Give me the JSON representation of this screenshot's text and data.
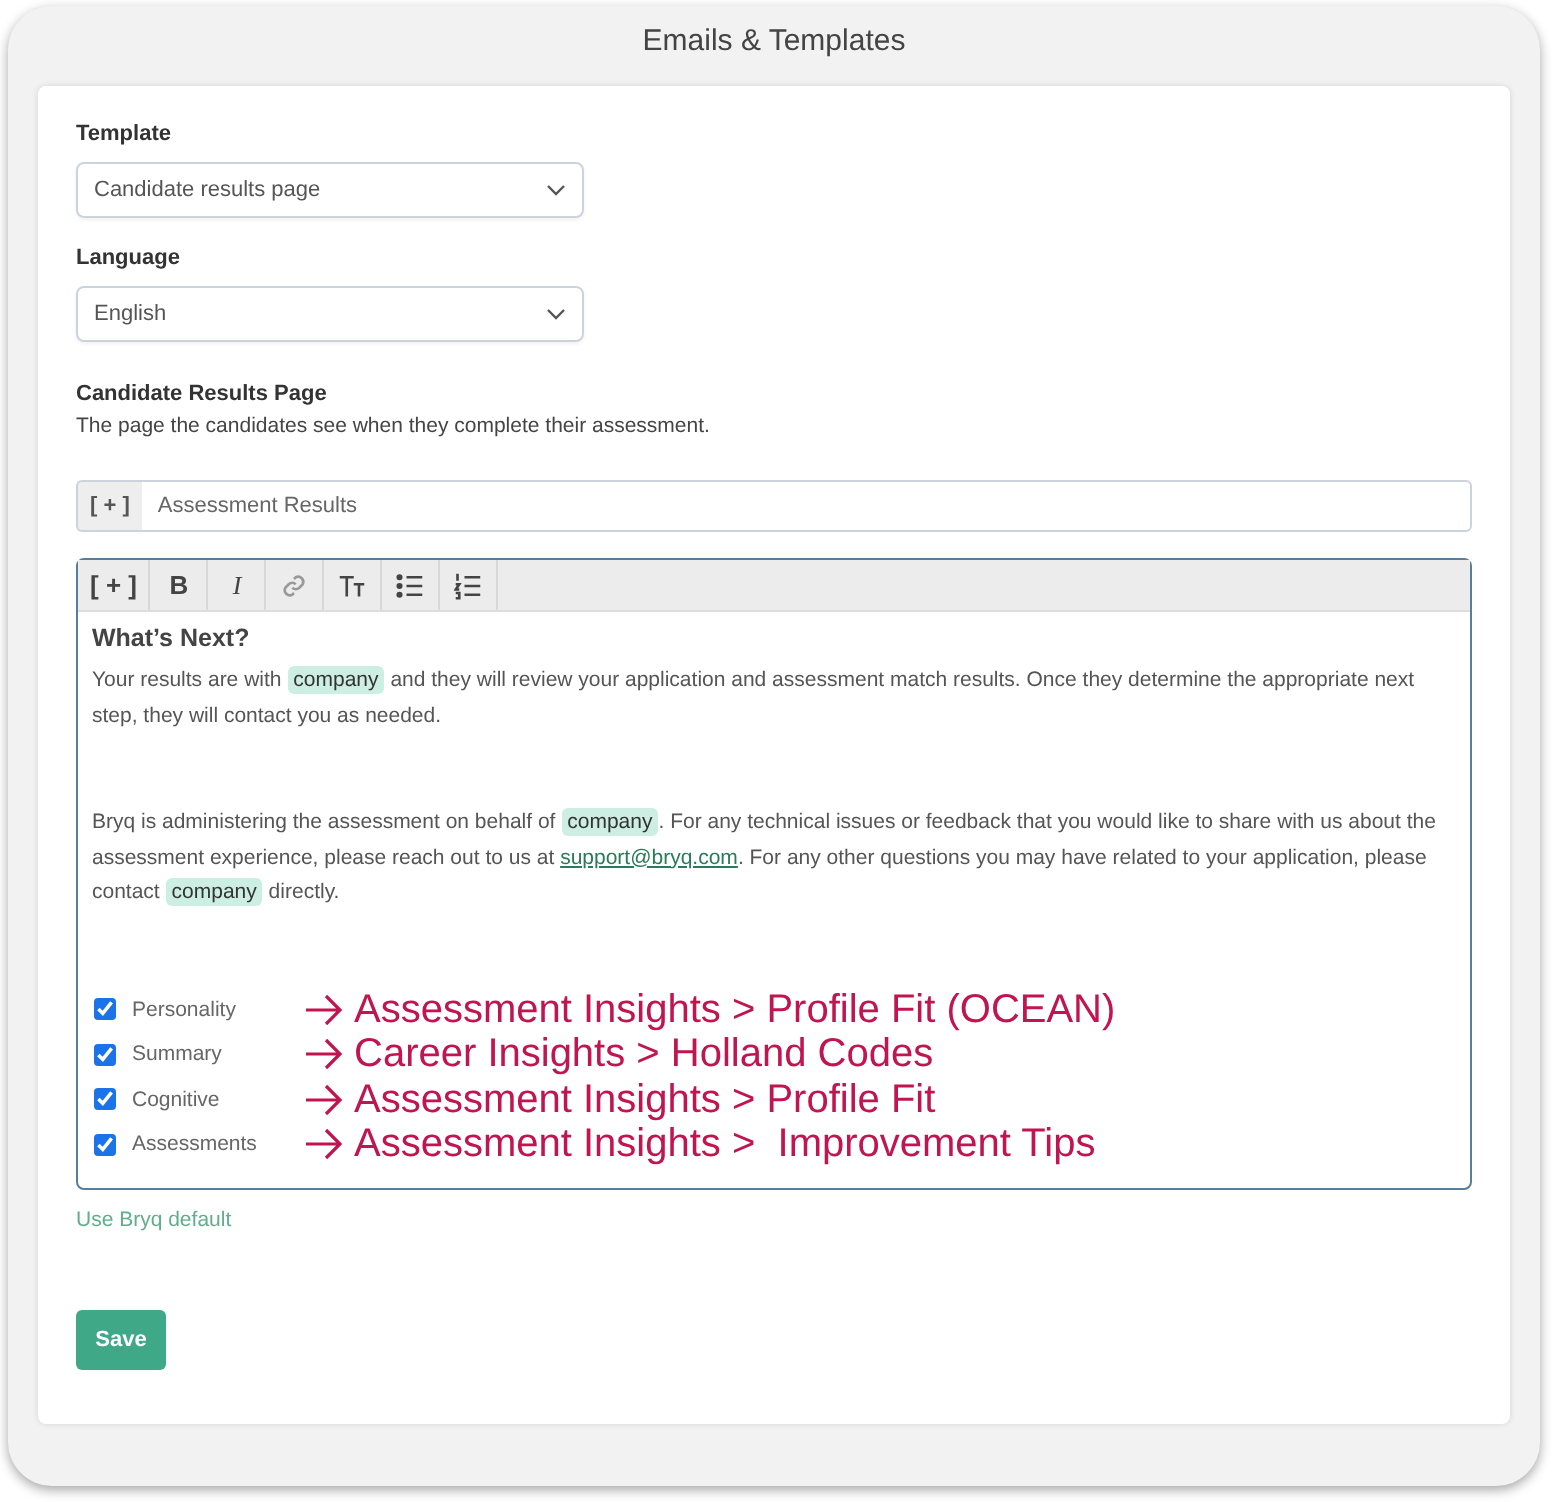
{
  "window": {
    "title": "Emails & Templates"
  },
  "template": {
    "label": "Template",
    "value": "Candidate results page"
  },
  "language": {
    "label": "Language",
    "value": "English"
  },
  "section": {
    "title": "Candidate Results Page",
    "description": "The page the candidates see when they complete their assessment."
  },
  "subject": {
    "prefix": "[ + ]",
    "value": "Assessment Results"
  },
  "toolbar": [
    {
      "kind": "insert",
      "label": "[ + ]"
    },
    {
      "kind": "bold",
      "label": "B"
    },
    {
      "kind": "italic",
      "label": "I"
    },
    {
      "kind": "link"
    },
    {
      "kind": "textsize"
    },
    {
      "kind": "bullets"
    },
    {
      "kind": "numbers"
    }
  ],
  "editor": {
    "heading": "What’s Next?",
    "paragraphs": [
      [
        {
          "kind": "text",
          "text": "Your results are with "
        },
        {
          "kind": "tag",
          "text": "company"
        },
        {
          "kind": "text",
          "text": " and they will review your application and assessment match results. Once they determine the appropriate next step, they will contact you as needed."
        }
      ],
      [
        {
          "kind": "text",
          "text": "Bryq is administering the assessment on behalf of "
        },
        {
          "kind": "tag",
          "text": "company"
        },
        {
          "kind": "text",
          "text": ". For any technical issues or feedback that you would like to share with us about the assessment experience, please reach out to us at "
        },
        {
          "kind": "link",
          "text": "support@bryq.com"
        },
        {
          "kind": "text",
          "text": ". For any other questions you may have related to your application, please contact "
        },
        {
          "kind": "tag",
          "text": "company"
        },
        {
          "kind": "text",
          "text": " directly."
        }
      ]
    ],
    "options": [
      {
        "label": "Personality",
        "checked": true,
        "annotation": "Assessment Insights > Profile Fit (OCEAN)"
      },
      {
        "label": "Summary",
        "checked": true,
        "annotation": "Career Insights > Holland Codes"
      },
      {
        "label": "Cognitive",
        "checked": true,
        "annotation": "Assessment Insights > Profile Fit"
      },
      {
        "label": "Assessments",
        "checked": true,
        "annotation": "Assessment Insights >  Improvement Tips"
      }
    ]
  },
  "default_link": "Use Bryq default",
  "save_button": "Save"
}
